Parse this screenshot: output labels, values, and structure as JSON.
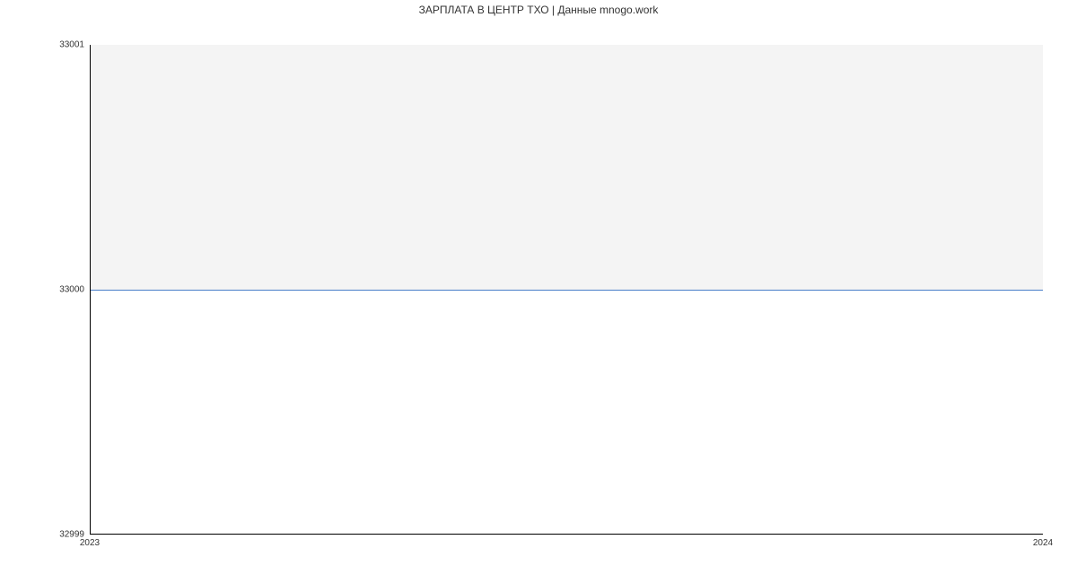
{
  "chart_data": {
    "type": "line",
    "title": "ЗАРПЛАТА В ЦЕНТР ТХО | Данные mnogo.work",
    "xlabel": "",
    "ylabel": "",
    "x": [
      2023,
      2024
    ],
    "values": [
      33000,
      33000
    ],
    "ylim": [
      32999,
      33001
    ],
    "xlim": [
      2023,
      2024
    ],
    "y_ticks": [
      32999,
      33000,
      33001
    ],
    "x_ticks": [
      2023,
      2024
    ],
    "line_color": "#4a7fc9"
  }
}
